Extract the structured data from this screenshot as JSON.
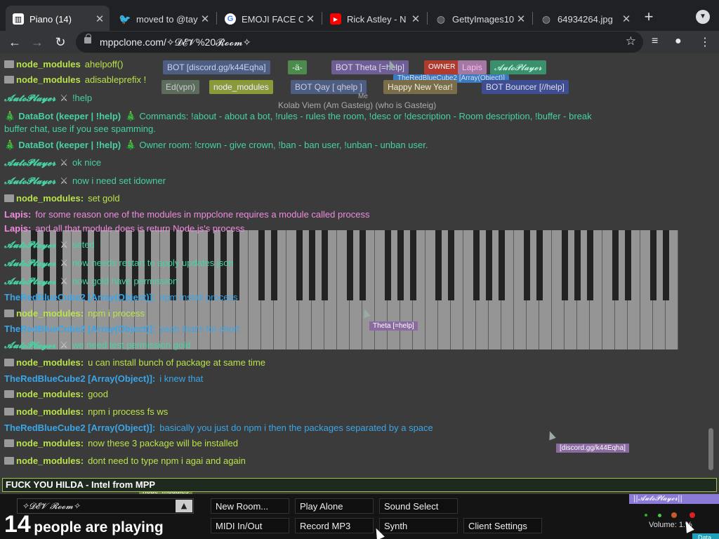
{
  "browser": {
    "tabs": [
      {
        "title": "Piano (14)",
        "icon": "piano-icon",
        "active": true
      },
      {
        "title": "moved to @tay",
        "icon": "twitter-icon"
      },
      {
        "title": "EMOJI FACE C",
        "icon": "google-icon"
      },
      {
        "title": "Rick Astley - N",
        "icon": "youtube-icon"
      },
      {
        "title": "GettyImages10",
        "icon": "globe-icon"
      },
      {
        "title": "64934264.jpg",
        "icon": "globe-icon"
      }
    ],
    "new_tab_label": "+",
    "address": "mppclone.com/✧𝓓𝓔𝓥%20𝓡𝓸𝓸𝓶✧"
  },
  "userlist": [
    {
      "label": "node_modules",
      "color": "#6e7b4a"
    },
    {
      "label": "BOT",
      "color": "#5a6b8a"
    },
    {
      "label": "[discord.gg/k44Eqha]",
      "color": "#5a6b8a"
    },
    {
      "label": "-ä-",
      "color": "#4e8a4e"
    },
    {
      "label": "BOT  Theta [=help]",
      "color": "#7a6a9a"
    },
    {
      "label": "OWNER",
      "color": "#b03a2e"
    },
    {
      "label": "Lapis",
      "color": "#c090c0"
    },
    {
      "label": "𝓐𝓾𝓽𝓸𝓟𝓵𝓪𝔂𝓮𝓻",
      "color": "#3aa67a"
    },
    {
      "label": "TheRedBlueCube2 [Array(Object)]",
      "color": "#3a7ac0"
    },
    {
      "label": "Ed(vpn)",
      "color": "#6a7a6a"
    },
    {
      "label": "node_modules",
      "color": "#a0b04a"
    },
    {
      "label": "BOT  Qay  [ qhelp ]",
      "color": "#5a6b8a"
    },
    {
      "label": "Happy New Year!",
      "color": "#9a8a5a"
    },
    {
      "label": "BOT  Bouncer [//help]",
      "color": "#4a5aa0"
    },
    {
      "label": "Kolab Viem (Am Gasteig) (who is Gasteig)",
      "color": "#444444"
    },
    {
      "label": "Me",
      "color": "#555555"
    }
  ],
  "chat": [
    {
      "name": "node_modules",
      "type": "node",
      "text": "ahelpoff()"
    },
    {
      "name": "node_modules",
      "type": "node",
      "text": "adisableprefix !"
    },
    {
      "name": "𝓐𝓾𝓽𝓸𝓟𝓵𝓪𝔂𝓮𝓻",
      "type": "auto",
      "text": "!help"
    },
    {
      "name": "DataBot (keeper | !help)",
      "type": "data",
      "text": "Commands: !about - about a bot, !rules - rules the room, !desc or !description - Room description, !buffer - break"
    },
    {
      "name": "",
      "type": "data-cont",
      "text": "buffer chat, use if you see spamming."
    },
    {
      "name": "DataBot (keeper | !help)",
      "type": "data",
      "text": "Owner room: !crown - give crown, !ban - ban user, !unban - unban user."
    },
    {
      "name": "𝓐𝓾𝓽𝓸𝓟𝓵𝓪𝔂𝓮𝓻",
      "type": "auto",
      "text": "ok nice"
    },
    {
      "name": "𝓐𝓾𝓽𝓸𝓟𝓵𝓪𝔂𝓮𝓻",
      "type": "auto",
      "text": "now i need set idowner"
    },
    {
      "name": "node_modules:",
      "type": "node",
      "text": "set gold"
    },
    {
      "name": "Lapis:",
      "type": "lapis",
      "text": "for some reason one of the modules in mppclone requires a module called process"
    },
    {
      "name": "Lapis:",
      "type": "lapis",
      "text": "and all that module does is return Node.js's process"
    },
    {
      "name": "𝓐𝓾𝓽𝓸𝓟𝓵𝓪𝔂𝓮𝓻",
      "type": "auto",
      "text": "seted"
    },
    {
      "name": "𝓐𝓾𝓽𝓸𝓟𝓵𝓪𝔂𝓮𝓻",
      "type": "auto",
      "text": "now needs restart to apply updates json"
    },
    {
      "name": "𝓐𝓾𝓽𝓸𝓟𝓵𝓪𝔂𝓮𝓻",
      "type": "auto",
      "text": "now gold have permission"
    },
    {
      "name": "TheRedBlueCube2 [Array(Object)]:",
      "type": "red",
      "text": "npm install process"
    },
    {
      "name": "node_modules:",
      "type": "node",
      "text": "npm i process"
    },
    {
      "name": "TheRedBlueCube2 [Array(Object)]:",
      "type": "red",
      "text": "yeah that's for short"
    },
    {
      "name": "𝓐𝓾𝓽𝓸𝓟𝓵𝓪𝔂𝓮𝓻",
      "type": "auto",
      "text": "we need test permission gold"
    },
    {
      "name": "node_modules:",
      "type": "node",
      "text": "u can install bunch of package at same time"
    },
    {
      "name": "TheRedBlueCube2 [Array(Object)]:",
      "type": "red",
      "text": "i knew that"
    },
    {
      "name": "node_modules:",
      "type": "node",
      "text": "good"
    },
    {
      "name": "node_modules:",
      "type": "node",
      "text": "npm i process fs ws"
    },
    {
      "name": "TheRedBlueCube2 [Array(Object)]:",
      "type": "red",
      "text": "basically you just do npm i then the packages separated by a space"
    },
    {
      "name": "node_modules:",
      "type": "node",
      "text": "now these 3 package will be installed"
    },
    {
      "name": "node_modules:",
      "type": "node",
      "text": "dont need to type npm i agai and again"
    }
  ],
  "chat_input": "FUCK YOU HILDA - Intel from MPP",
  "floating_labels": {
    "theta": "Theta [=help]",
    "discord": "[discord.gg/k44Eqha]",
    "redblue": "TheRedBlueCube2 [Array(Object)]",
    "node": "node_modules"
  },
  "bottom": {
    "room_name": "✧𝓓𝓔𝓥 𝓡𝓸𝓸𝓶✧",
    "room_arrow": "▲",
    "people_count": "14",
    "people_text": "people are playing",
    "buttons": {
      "new_room": "New Room...",
      "play_alone": "Play Alone",
      "sound_select": "Sound Select",
      "midi": "MIDI In/Out",
      "record": "Record MP3",
      "synth": "Synth",
      "client_settings": "Client Settings"
    },
    "volume_label": "Volume:",
    "volume_value": "1.%",
    "sticky_name": "||𝓐𝓾𝓽𝓸𝓟𝓵𝓪𝔂𝓮𝓻||",
    "data_tag": "Data"
  }
}
